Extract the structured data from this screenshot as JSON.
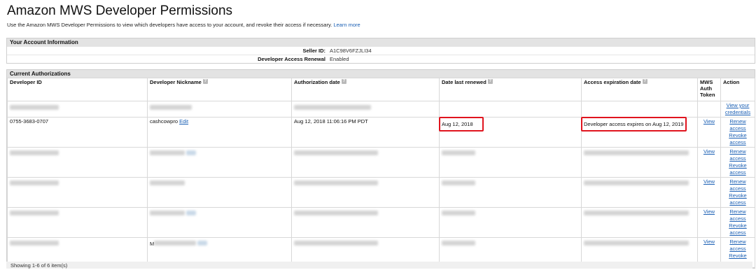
{
  "page": {
    "title": "Amazon MWS Developer Permissions",
    "intro": "Use the Amazon MWS Developer Permissions to view which developers have access to your account, and revoke their access if necessary.",
    "learn_more": "Learn more"
  },
  "account": {
    "heading": "Your Account Information",
    "seller_id_label": "Seller ID:",
    "seller_id": "A1C98V6FZJLI34",
    "renewal_label": "Developer Access Renewal",
    "renewal_value": "Enabled"
  },
  "auth": {
    "heading": "Current Authorizations",
    "columns": {
      "developer_id": "Developer ID",
      "nickname": "Developer Nickname",
      "auth_date": "Authorization date",
      "last_renewed": "Date last renewed",
      "expiration": "Access expiration date",
      "mws_token": "MWS Auth Token",
      "action": "Action"
    },
    "help_glyph": "?",
    "view_credentials": "View your credentials",
    "visible_row": {
      "developer_id": "0755-3683-0707",
      "nickname": "cashcowpro",
      "edit": "Edit",
      "auth_date": "Aug 12, 2018 11:06:16 PM PDT",
      "last_renewed": "Aug 12, 2018",
      "expiration_prefix": "Developer access expires on",
      "expiration_date": "Aug 12, 2019"
    },
    "view": "View",
    "renew": "Renew access",
    "revoke": "Revoke access",
    "partial_nickname_char": "M"
  },
  "footer": {
    "showing": "Showing 1-6 of 6 item(s)"
  },
  "colors": {
    "link": "#1a5fb4",
    "highlight": "#e0141e",
    "header_bg": "#e3e3e3"
  }
}
